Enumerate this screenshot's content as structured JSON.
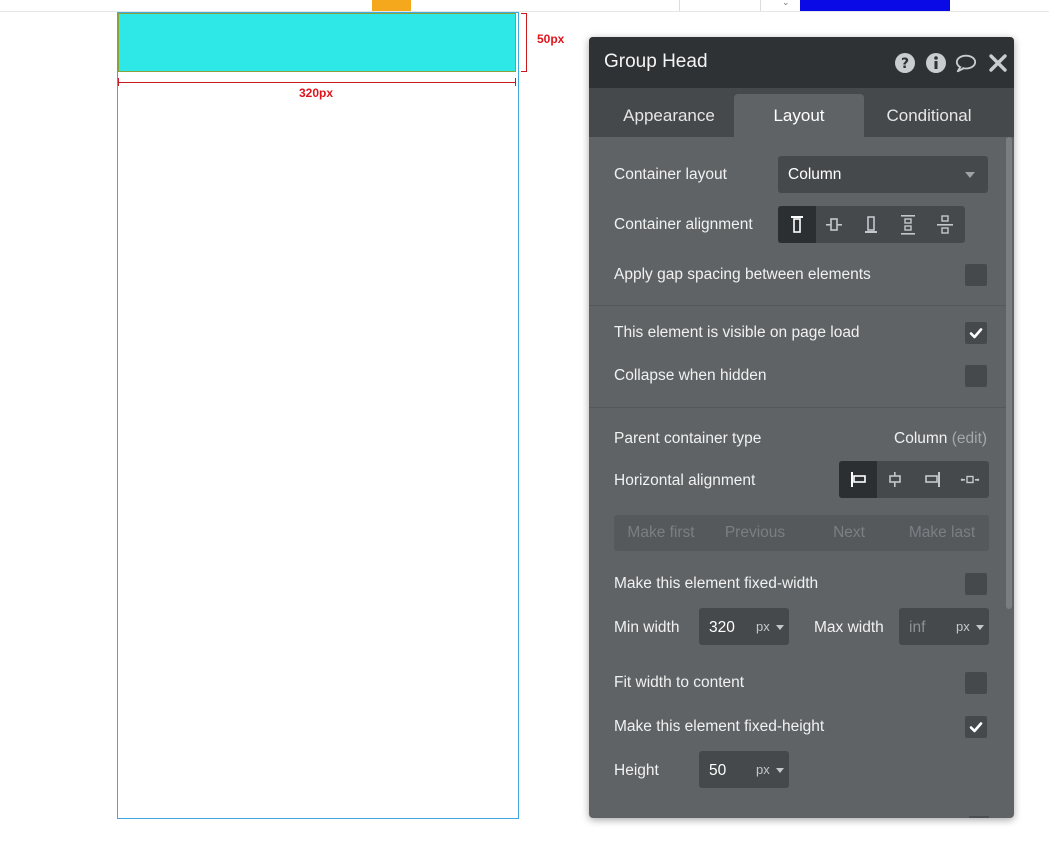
{
  "canvas": {
    "width_label": "320px",
    "height_label": "50px",
    "group_color": "#2ee8e8"
  },
  "panel": {
    "title": "Group Head",
    "header_icons": [
      "help-icon",
      "info-icon",
      "comment-icon",
      "close-icon"
    ],
    "tabs": [
      {
        "label": "Appearance",
        "active": false
      },
      {
        "label": "Layout",
        "active": true
      },
      {
        "label": "Conditional",
        "active": false
      }
    ],
    "container_layout": {
      "label": "Container layout",
      "value": "Column"
    },
    "container_alignment": {
      "label": "Container alignment",
      "options": [
        "align-top-icon",
        "align-center-vertical-icon",
        "align-bottom-icon",
        "distribute-spread-icon",
        "distribute-center-icon"
      ],
      "selected": 0
    },
    "gap_spacing": {
      "label": "Apply gap spacing between elements",
      "checked": false
    },
    "visible_on_load": {
      "label": "This element is visible on page load",
      "checked": true
    },
    "collapse_hidden": {
      "label": "Collapse when hidden",
      "checked": false
    },
    "parent_container": {
      "label": "Parent container type",
      "value": "Column",
      "edit": "(edit)"
    },
    "horizontal_alignment": {
      "label": "Horizontal alignment",
      "options": [
        "align-left-icon",
        "align-center-horizontal-icon",
        "align-right-icon",
        "align-stretch-icon"
      ],
      "selected": 0
    },
    "order_buttons": [
      "Make first",
      "Previous",
      "Next",
      "Make last"
    ],
    "fixed_width": {
      "label": "Make this element fixed-width",
      "checked": false
    },
    "min_width": {
      "label": "Min width",
      "value": "320",
      "unit": "px"
    },
    "max_width": {
      "label": "Max width",
      "placeholder": "inf",
      "unit": "px"
    },
    "fit_width": {
      "label": "Fit width to content",
      "checked": false
    },
    "fixed_height": {
      "label": "Make this element fixed-height",
      "checked": true
    },
    "height": {
      "label": "Height",
      "value": "50",
      "unit": "px"
    }
  }
}
